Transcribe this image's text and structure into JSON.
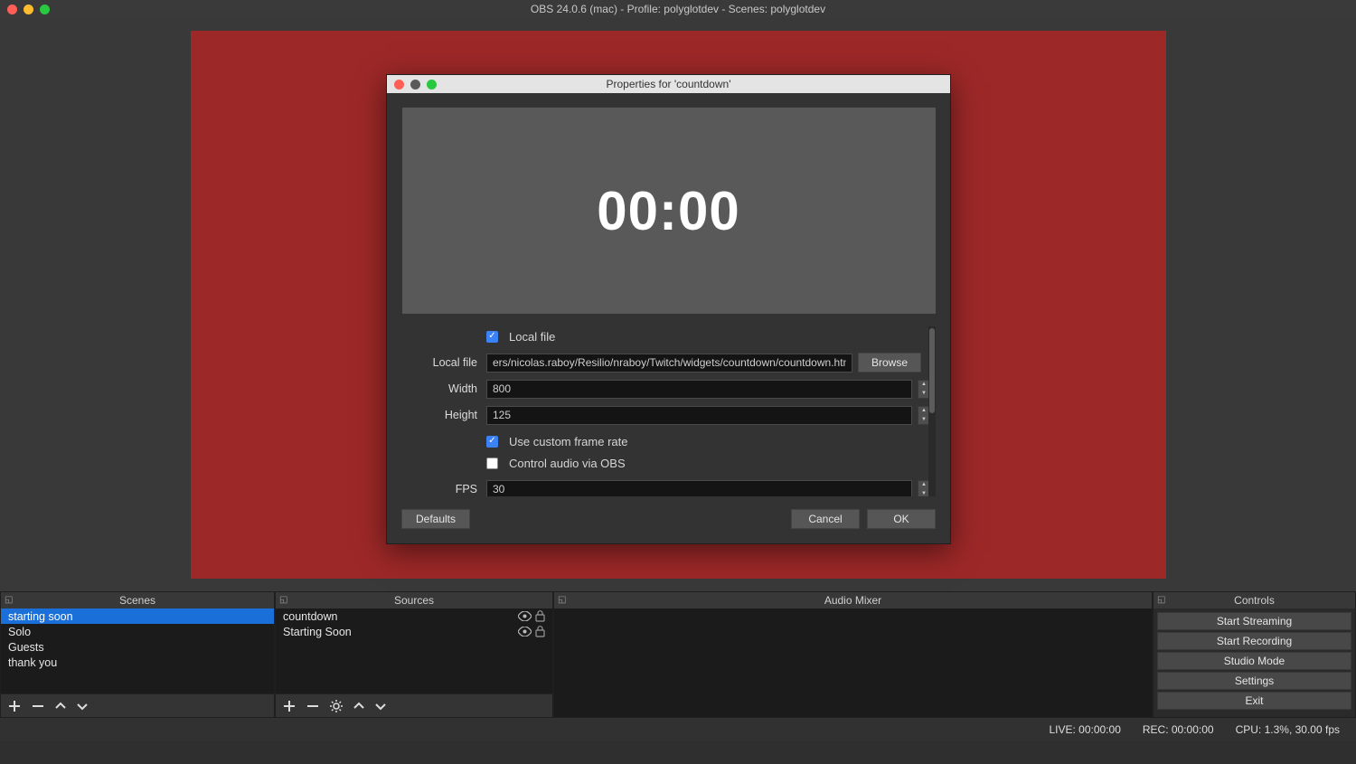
{
  "app": {
    "title": "OBS 24.0.6 (mac) - Profile: polyglotdev - Scenes: polyglotdev"
  },
  "preview": {
    "countdown_display": "00:00",
    "bg_color": "#9d2828"
  },
  "dialog": {
    "title": "Properties for 'countdown'",
    "labels": {
      "local_file_checkbox": "Local file",
      "local_file": "Local file",
      "width": "Width",
      "height": "Height",
      "use_custom_frame_rate": "Use custom frame rate",
      "control_audio": "Control audio via OBS",
      "fps": "FPS"
    },
    "values": {
      "local_file_checked": true,
      "file_path": "ers/nicolas.raboy/Resilio/nraboy/Twitch/widgets/countdown/countdown.html",
      "width": "800",
      "height": "125",
      "use_custom_frame_rate_checked": true,
      "control_audio_checked": false,
      "fps": "30"
    },
    "buttons": {
      "browse": "Browse",
      "defaults": "Defaults",
      "cancel": "Cancel",
      "ok": "OK"
    }
  },
  "panels": {
    "scenes": {
      "title": "Scenes",
      "items": [
        {
          "label": "starting soon",
          "selected": true
        },
        {
          "label": "Solo",
          "selected": false
        },
        {
          "label": "Guests",
          "selected": false
        },
        {
          "label": "thank you",
          "selected": false
        }
      ]
    },
    "sources": {
      "title": "Sources",
      "items": [
        {
          "label": "countdown"
        },
        {
          "label": "Starting Soon"
        }
      ]
    },
    "mixer": {
      "title": "Audio Mixer"
    },
    "controls": {
      "title": "Controls",
      "buttons": {
        "start_streaming": "Start Streaming",
        "start_recording": "Start Recording",
        "studio_mode": "Studio Mode",
        "settings": "Settings",
        "exit": "Exit"
      }
    }
  },
  "statusbar": {
    "live": "LIVE: 00:00:00",
    "rec": "REC: 00:00:00",
    "cpu": "CPU: 1.3%, 30.00 fps"
  }
}
